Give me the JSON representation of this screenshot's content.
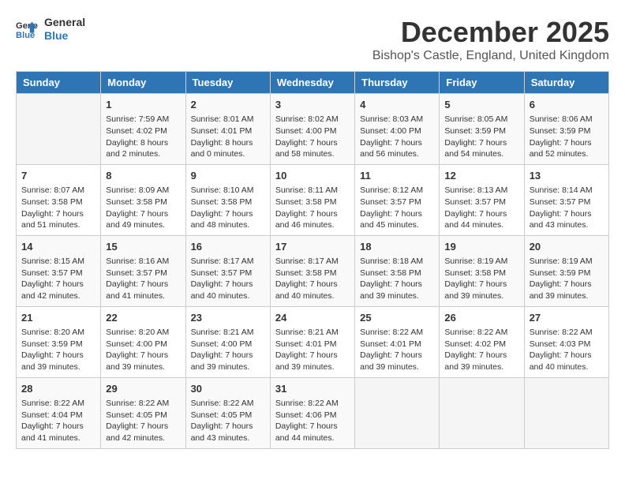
{
  "logo": {
    "line1": "General",
    "line2": "Blue"
  },
  "title": "December 2025",
  "location": "Bishop's Castle, England, United Kingdom",
  "days_header": [
    "Sunday",
    "Monday",
    "Tuesday",
    "Wednesday",
    "Thursday",
    "Friday",
    "Saturday"
  ],
  "weeks": [
    [
      {
        "day": "",
        "sunrise": "",
        "sunset": "",
        "daylight": ""
      },
      {
        "day": "1",
        "sunrise": "Sunrise: 7:59 AM",
        "sunset": "Sunset: 4:02 PM",
        "daylight": "Daylight: 8 hours and 2 minutes."
      },
      {
        "day": "2",
        "sunrise": "Sunrise: 8:01 AM",
        "sunset": "Sunset: 4:01 PM",
        "daylight": "Daylight: 8 hours and 0 minutes."
      },
      {
        "day": "3",
        "sunrise": "Sunrise: 8:02 AM",
        "sunset": "Sunset: 4:00 PM",
        "daylight": "Daylight: 7 hours and 58 minutes."
      },
      {
        "day": "4",
        "sunrise": "Sunrise: 8:03 AM",
        "sunset": "Sunset: 4:00 PM",
        "daylight": "Daylight: 7 hours and 56 minutes."
      },
      {
        "day": "5",
        "sunrise": "Sunrise: 8:05 AM",
        "sunset": "Sunset: 3:59 PM",
        "daylight": "Daylight: 7 hours and 54 minutes."
      },
      {
        "day": "6",
        "sunrise": "Sunrise: 8:06 AM",
        "sunset": "Sunset: 3:59 PM",
        "daylight": "Daylight: 7 hours and 52 minutes."
      }
    ],
    [
      {
        "day": "7",
        "sunrise": "Sunrise: 8:07 AM",
        "sunset": "Sunset: 3:58 PM",
        "daylight": "Daylight: 7 hours and 51 minutes."
      },
      {
        "day": "8",
        "sunrise": "Sunrise: 8:09 AM",
        "sunset": "Sunset: 3:58 PM",
        "daylight": "Daylight: 7 hours and 49 minutes."
      },
      {
        "day": "9",
        "sunrise": "Sunrise: 8:10 AM",
        "sunset": "Sunset: 3:58 PM",
        "daylight": "Daylight: 7 hours and 48 minutes."
      },
      {
        "day": "10",
        "sunrise": "Sunrise: 8:11 AM",
        "sunset": "Sunset: 3:58 PM",
        "daylight": "Daylight: 7 hours and 46 minutes."
      },
      {
        "day": "11",
        "sunrise": "Sunrise: 8:12 AM",
        "sunset": "Sunset: 3:57 PM",
        "daylight": "Daylight: 7 hours and 45 minutes."
      },
      {
        "day": "12",
        "sunrise": "Sunrise: 8:13 AM",
        "sunset": "Sunset: 3:57 PM",
        "daylight": "Daylight: 7 hours and 44 minutes."
      },
      {
        "day": "13",
        "sunrise": "Sunrise: 8:14 AM",
        "sunset": "Sunset: 3:57 PM",
        "daylight": "Daylight: 7 hours and 43 minutes."
      }
    ],
    [
      {
        "day": "14",
        "sunrise": "Sunrise: 8:15 AM",
        "sunset": "Sunset: 3:57 PM",
        "daylight": "Daylight: 7 hours and 42 minutes."
      },
      {
        "day": "15",
        "sunrise": "Sunrise: 8:16 AM",
        "sunset": "Sunset: 3:57 PM",
        "daylight": "Daylight: 7 hours and 41 minutes."
      },
      {
        "day": "16",
        "sunrise": "Sunrise: 8:17 AM",
        "sunset": "Sunset: 3:57 PM",
        "daylight": "Daylight: 7 hours and 40 minutes."
      },
      {
        "day": "17",
        "sunrise": "Sunrise: 8:17 AM",
        "sunset": "Sunset: 3:58 PM",
        "daylight": "Daylight: 7 hours and 40 minutes."
      },
      {
        "day": "18",
        "sunrise": "Sunrise: 8:18 AM",
        "sunset": "Sunset: 3:58 PM",
        "daylight": "Daylight: 7 hours and 39 minutes."
      },
      {
        "day": "19",
        "sunrise": "Sunrise: 8:19 AM",
        "sunset": "Sunset: 3:58 PM",
        "daylight": "Daylight: 7 hours and 39 minutes."
      },
      {
        "day": "20",
        "sunrise": "Sunrise: 8:19 AM",
        "sunset": "Sunset: 3:59 PM",
        "daylight": "Daylight: 7 hours and 39 minutes."
      }
    ],
    [
      {
        "day": "21",
        "sunrise": "Sunrise: 8:20 AM",
        "sunset": "Sunset: 3:59 PM",
        "daylight": "Daylight: 7 hours and 39 minutes."
      },
      {
        "day": "22",
        "sunrise": "Sunrise: 8:20 AM",
        "sunset": "Sunset: 4:00 PM",
        "daylight": "Daylight: 7 hours and 39 minutes."
      },
      {
        "day": "23",
        "sunrise": "Sunrise: 8:21 AM",
        "sunset": "Sunset: 4:00 PM",
        "daylight": "Daylight: 7 hours and 39 minutes."
      },
      {
        "day": "24",
        "sunrise": "Sunrise: 8:21 AM",
        "sunset": "Sunset: 4:01 PM",
        "daylight": "Daylight: 7 hours and 39 minutes."
      },
      {
        "day": "25",
        "sunrise": "Sunrise: 8:22 AM",
        "sunset": "Sunset: 4:01 PM",
        "daylight": "Daylight: 7 hours and 39 minutes."
      },
      {
        "day": "26",
        "sunrise": "Sunrise: 8:22 AM",
        "sunset": "Sunset: 4:02 PM",
        "daylight": "Daylight: 7 hours and 39 minutes."
      },
      {
        "day": "27",
        "sunrise": "Sunrise: 8:22 AM",
        "sunset": "Sunset: 4:03 PM",
        "daylight": "Daylight: 7 hours and 40 minutes."
      }
    ],
    [
      {
        "day": "28",
        "sunrise": "Sunrise: 8:22 AM",
        "sunset": "Sunset: 4:04 PM",
        "daylight": "Daylight: 7 hours and 41 minutes."
      },
      {
        "day": "29",
        "sunrise": "Sunrise: 8:22 AM",
        "sunset": "Sunset: 4:05 PM",
        "daylight": "Daylight: 7 hours and 42 minutes."
      },
      {
        "day": "30",
        "sunrise": "Sunrise: 8:22 AM",
        "sunset": "Sunset: 4:05 PM",
        "daylight": "Daylight: 7 hours and 43 minutes."
      },
      {
        "day": "31",
        "sunrise": "Sunrise: 8:22 AM",
        "sunset": "Sunset: 4:06 PM",
        "daylight": "Daylight: 7 hours and 44 minutes."
      },
      {
        "day": "",
        "sunrise": "",
        "sunset": "",
        "daylight": ""
      },
      {
        "day": "",
        "sunrise": "",
        "sunset": "",
        "daylight": ""
      },
      {
        "day": "",
        "sunrise": "",
        "sunset": "",
        "daylight": ""
      }
    ]
  ]
}
